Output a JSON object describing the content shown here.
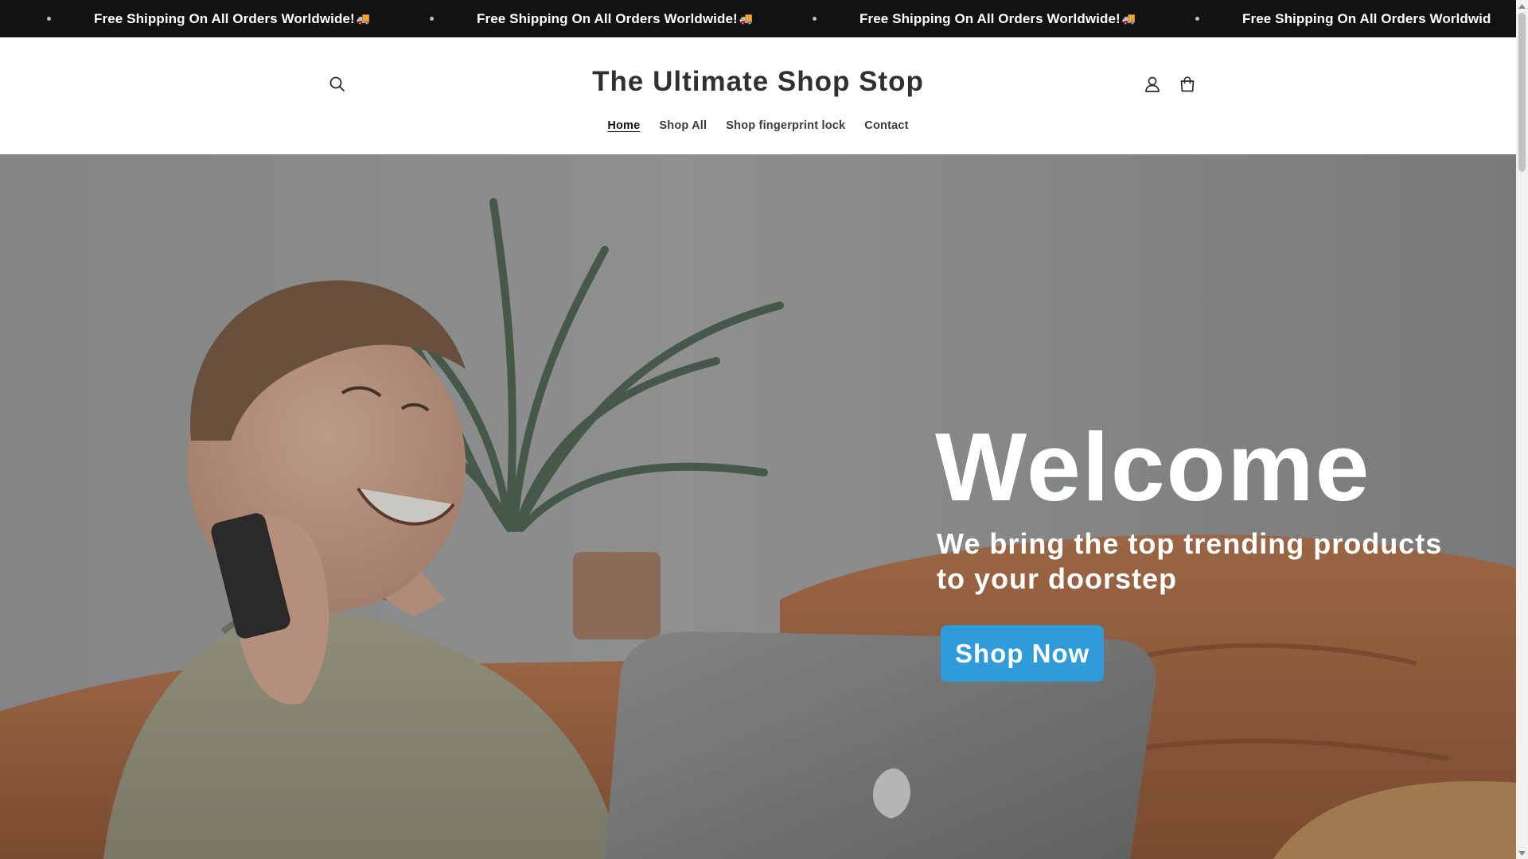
{
  "announcement": {
    "text": "Free Shipping On All Orders Worldwide!",
    "emoji": "🚚",
    "last_visible": "Free Shipping On All Orders Worldwid"
  },
  "header": {
    "logo": "The Ultimate Shop Stop",
    "icons": [
      "search-icon",
      "account-icon",
      "cart-icon"
    ],
    "nav": [
      {
        "label": "Home",
        "active": true
      },
      {
        "label": "Shop All",
        "active": false
      },
      {
        "label": "Shop fingerprint lock",
        "active": false
      },
      {
        "label": "Contact",
        "active": false
      }
    ]
  },
  "hero": {
    "title": "Welcome",
    "subtitle": "We bring the top trending products to your doorstep",
    "button": "Shop Now"
  },
  "colors": {
    "announcement_bg": "#121212",
    "button_bg": "#2f9bd9",
    "logo": "#303030"
  }
}
